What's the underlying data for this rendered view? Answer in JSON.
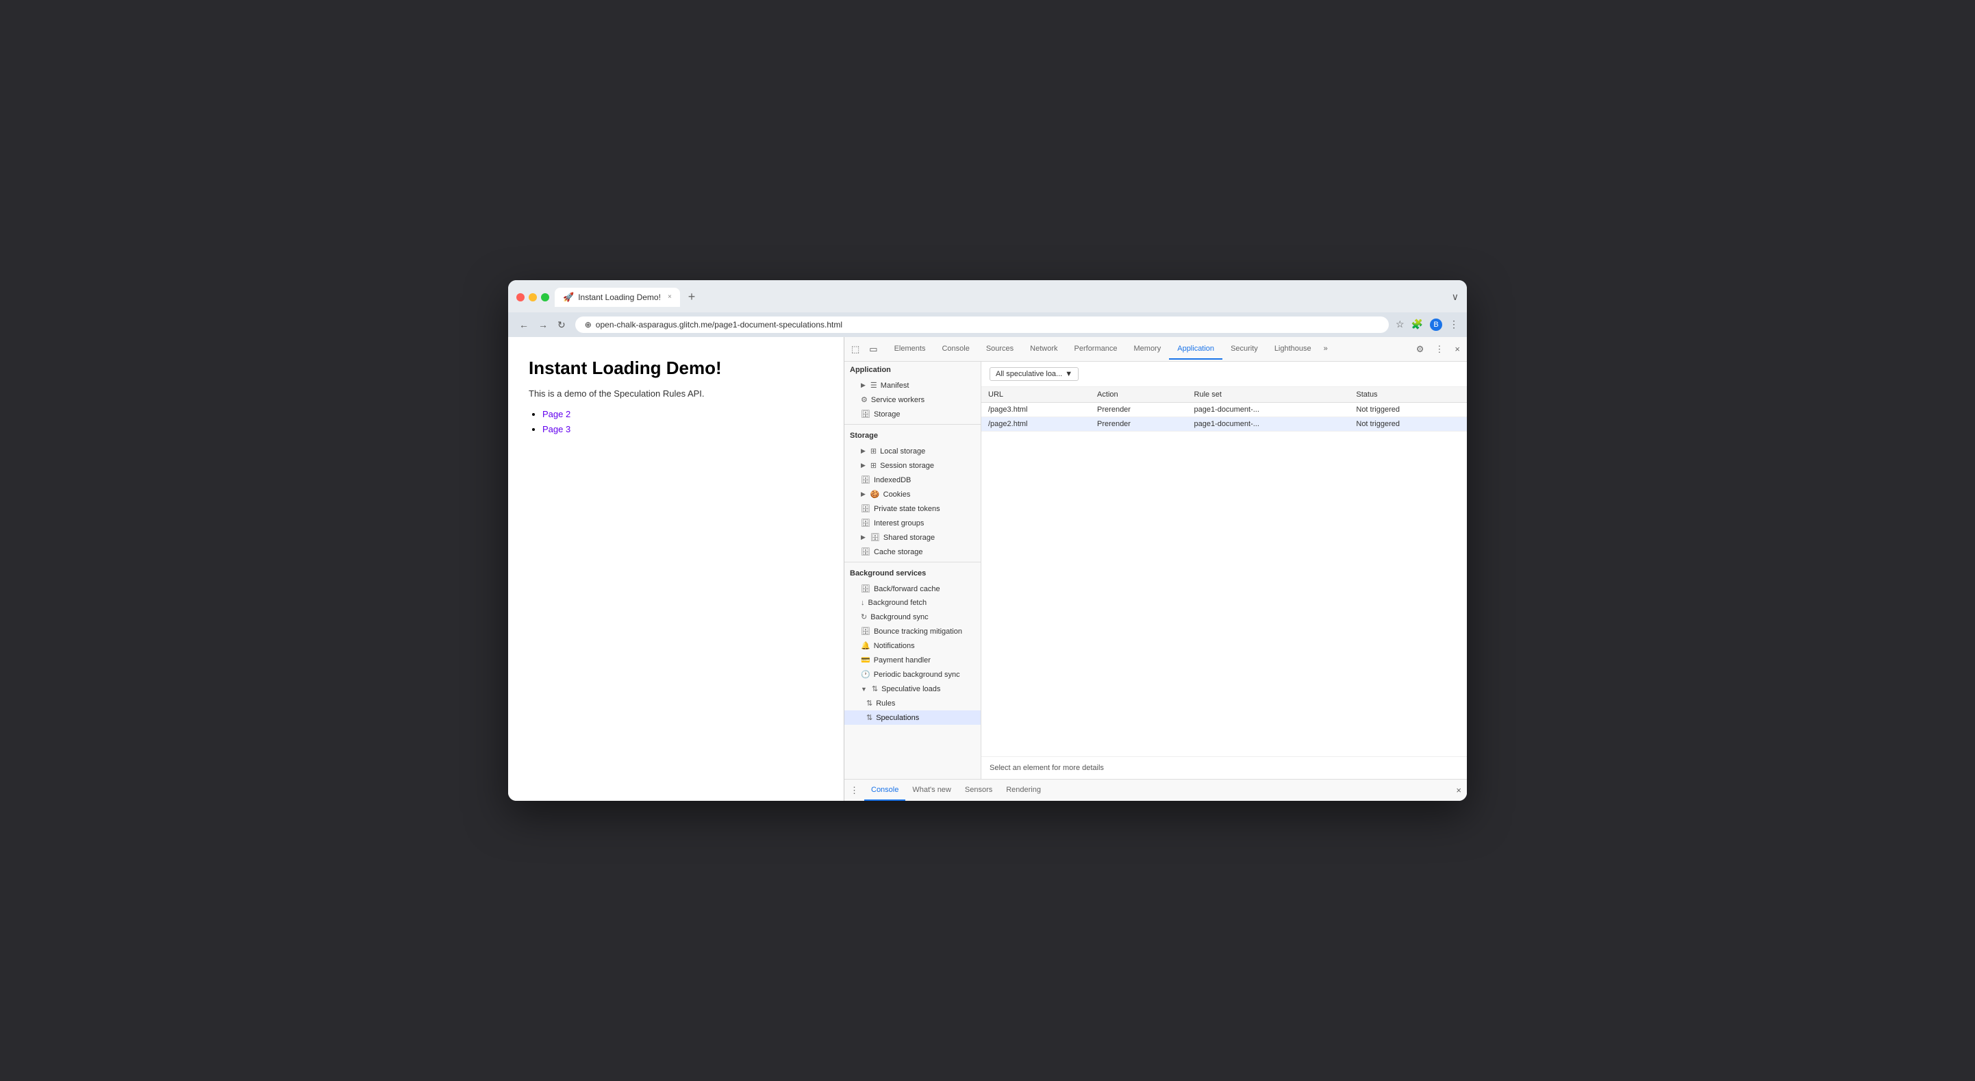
{
  "browser": {
    "traffic_lights": [
      "red",
      "yellow",
      "green"
    ],
    "tab": {
      "icon": "🚀",
      "title": "Instant Loading Demo!",
      "close": "×"
    },
    "new_tab_label": "+",
    "address": "open-chalk-asparagus.glitch.me/page1-document-speculations.html",
    "nav": {
      "back": "←",
      "forward": "→",
      "reload": "↻",
      "info_icon": "⊕"
    },
    "address_bar_icons": {
      "star": "☆",
      "extensions": "🧩",
      "profile": "B",
      "more": "⋮"
    },
    "collapse_btn": "∨"
  },
  "page": {
    "title": "Instant Loading Demo!",
    "description": "This is a demo of the Speculation Rules API.",
    "links": [
      {
        "label": "Page 2",
        "href": "#"
      },
      {
        "label": "Page 3",
        "href": "#"
      }
    ]
  },
  "devtools": {
    "tabs": [
      {
        "label": "Elements",
        "active": false
      },
      {
        "label": "Console",
        "active": false
      },
      {
        "label": "Sources",
        "active": false
      },
      {
        "label": "Network",
        "active": false
      },
      {
        "label": "Performance",
        "active": false
      },
      {
        "label": "Memory",
        "active": false
      },
      {
        "label": "Application",
        "active": true
      },
      {
        "label": "Security",
        "active": false
      },
      {
        "label": "Lighthouse",
        "active": false
      }
    ],
    "more_tabs": "»",
    "toolbar_icons": {
      "inspect": "⬚",
      "device": "▭",
      "settings": "⚙",
      "more": "⋮",
      "close": "×"
    },
    "sidebar": {
      "sections": [
        {
          "label": "Application",
          "items": [
            {
              "label": "Manifest",
              "icon": "☰",
              "indent": 1,
              "arrow": "▶"
            },
            {
              "label": "Service workers",
              "icon": "⚙",
              "indent": 1
            },
            {
              "label": "Storage",
              "icon": "🗄",
              "indent": 1
            }
          ]
        },
        {
          "label": "Storage",
          "items": [
            {
              "label": "Local storage",
              "icon": "⊞",
              "indent": 1,
              "arrow": "▶"
            },
            {
              "label": "Session storage",
              "icon": "⊞",
              "indent": 1,
              "arrow": "▶"
            },
            {
              "label": "IndexedDB",
              "icon": "🗄",
              "indent": 1
            },
            {
              "label": "Cookies",
              "icon": "🍪",
              "indent": 1,
              "arrow": "▶"
            },
            {
              "label": "Private state tokens",
              "icon": "🗄",
              "indent": 1
            },
            {
              "label": "Interest groups",
              "icon": "🗄",
              "indent": 1
            },
            {
              "label": "Shared storage",
              "icon": "🗄",
              "indent": 1,
              "arrow": "▶"
            },
            {
              "label": "Cache storage",
              "icon": "🗄",
              "indent": 1
            }
          ]
        },
        {
          "label": "Background services",
          "items": [
            {
              "label": "Back/forward cache",
              "icon": "🗄",
              "indent": 1
            },
            {
              "label": "Background fetch",
              "icon": "↓",
              "indent": 1
            },
            {
              "label": "Background sync",
              "icon": "↻",
              "indent": 1
            },
            {
              "label": "Bounce tracking mitigation",
              "icon": "🗄",
              "indent": 1
            },
            {
              "label": "Notifications",
              "icon": "🔔",
              "indent": 1
            },
            {
              "label": "Payment handler",
              "icon": "💳",
              "indent": 1
            },
            {
              "label": "Periodic background sync",
              "icon": "🕐",
              "indent": 1
            },
            {
              "label": "Speculative loads",
              "icon": "↕",
              "indent": 1,
              "arrow": "▼",
              "expanded": true
            },
            {
              "label": "Rules",
              "icon": "↕",
              "indent": 2
            },
            {
              "label": "Speculations",
              "icon": "↕",
              "indent": 2,
              "active": true
            }
          ]
        }
      ]
    },
    "main_panel": {
      "dropdown_label": "All speculative loa...",
      "dropdown_arrow": "▼",
      "table": {
        "columns": [
          "URL",
          "Action",
          "Rule set",
          "Status"
        ],
        "rows": [
          {
            "url": "/page3.html",
            "action": "Prerender",
            "rule_set": "page1-document-...",
            "status": "Not triggered"
          },
          {
            "url": "/page2.html",
            "action": "Prerender",
            "rule_set": "page1-document-...",
            "status": "Not triggered"
          }
        ]
      },
      "detail_text": "Select an element for more details"
    },
    "console_bar": {
      "icon": "⋮",
      "tabs": [
        {
          "label": "Console",
          "active": true
        },
        {
          "label": "What's new",
          "active": false
        },
        {
          "label": "Sensors",
          "active": false
        },
        {
          "label": "Rendering",
          "active": false
        }
      ],
      "close": "×"
    }
  }
}
